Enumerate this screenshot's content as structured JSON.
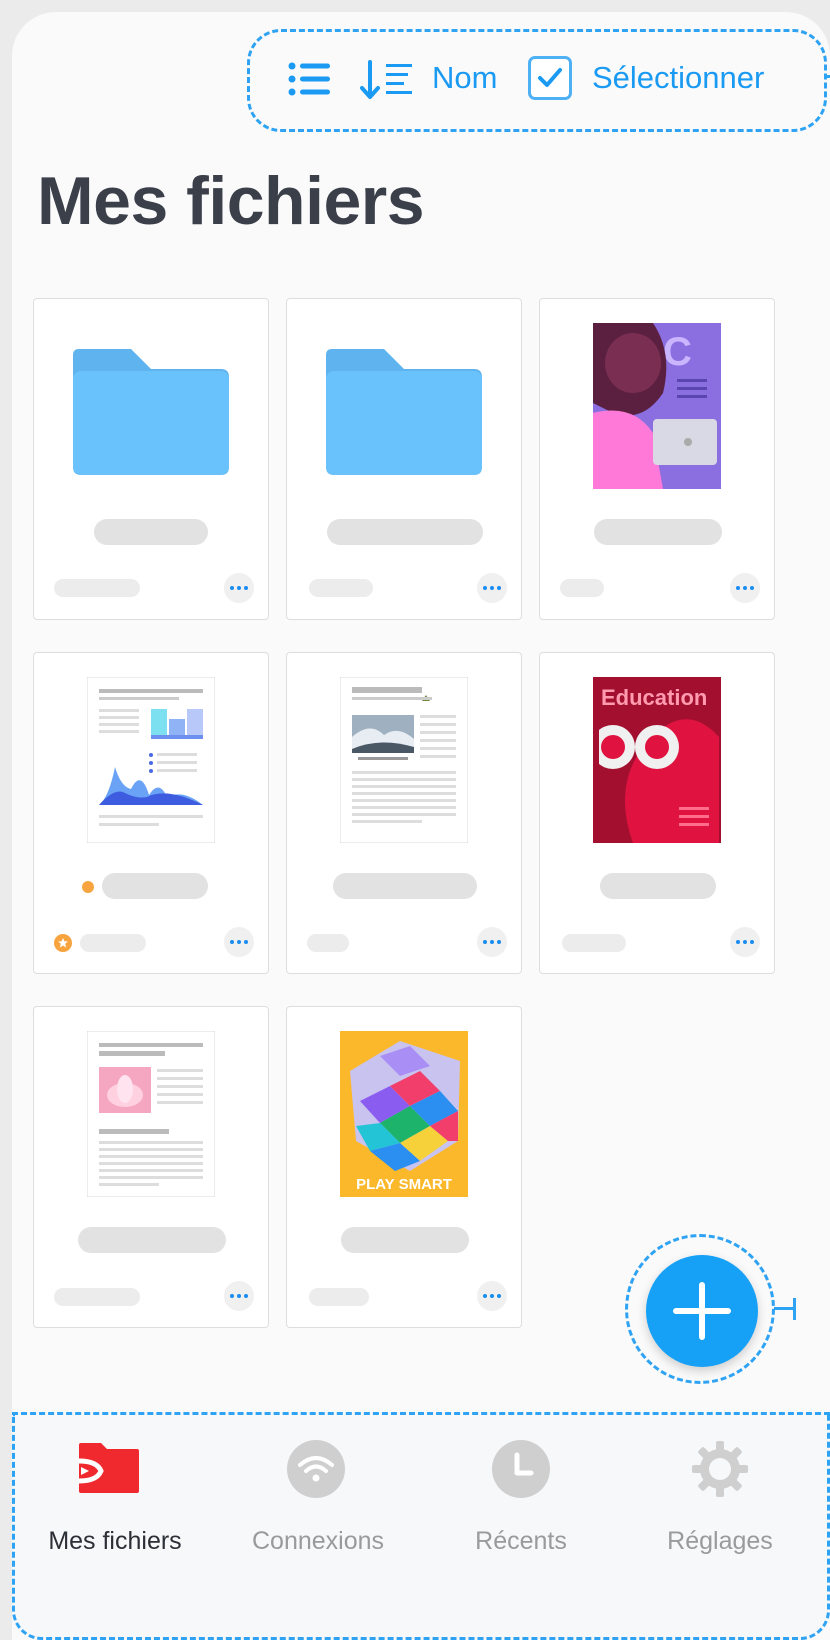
{
  "toolbar": {
    "list_icon": "list-icon",
    "sort_icon": "sort-icon",
    "sort_label": "Nom",
    "select_label": "Sélectionner"
  },
  "page_title": "Mes fichiers",
  "files": [
    {
      "kind": "folder",
      "thumb": "folder-icon"
    },
    {
      "kind": "folder",
      "thumb": "folder-icon"
    },
    {
      "kind": "document",
      "thumb": "cover-illustration"
    },
    {
      "kind": "document",
      "thumb": "report-chart"
    },
    {
      "kind": "document",
      "thumb": "article-page"
    },
    {
      "kind": "document",
      "thumb": "education-cover",
      "cover_text": "Education"
    },
    {
      "kind": "document",
      "thumb": "lotus-page"
    },
    {
      "kind": "document",
      "thumb": "cube-cover",
      "cover_text": "PLAY SMART"
    }
  ],
  "fab": {
    "icon": "plus-icon"
  },
  "tabs": [
    {
      "label": "Mes fichiers",
      "icon": "folder-play-icon",
      "active": true
    },
    {
      "label": "Connexions",
      "icon": "wifi-icon",
      "active": false
    },
    {
      "label": "Récents",
      "icon": "clock-icon",
      "active": false
    },
    {
      "label": "Réglages",
      "icon": "gear-icon",
      "active": false
    }
  ],
  "colors": {
    "accent": "#1a9af3",
    "folder": "#6ac2fd",
    "title": "#3a3f4a",
    "tab_active_icon": "#f0292f"
  }
}
